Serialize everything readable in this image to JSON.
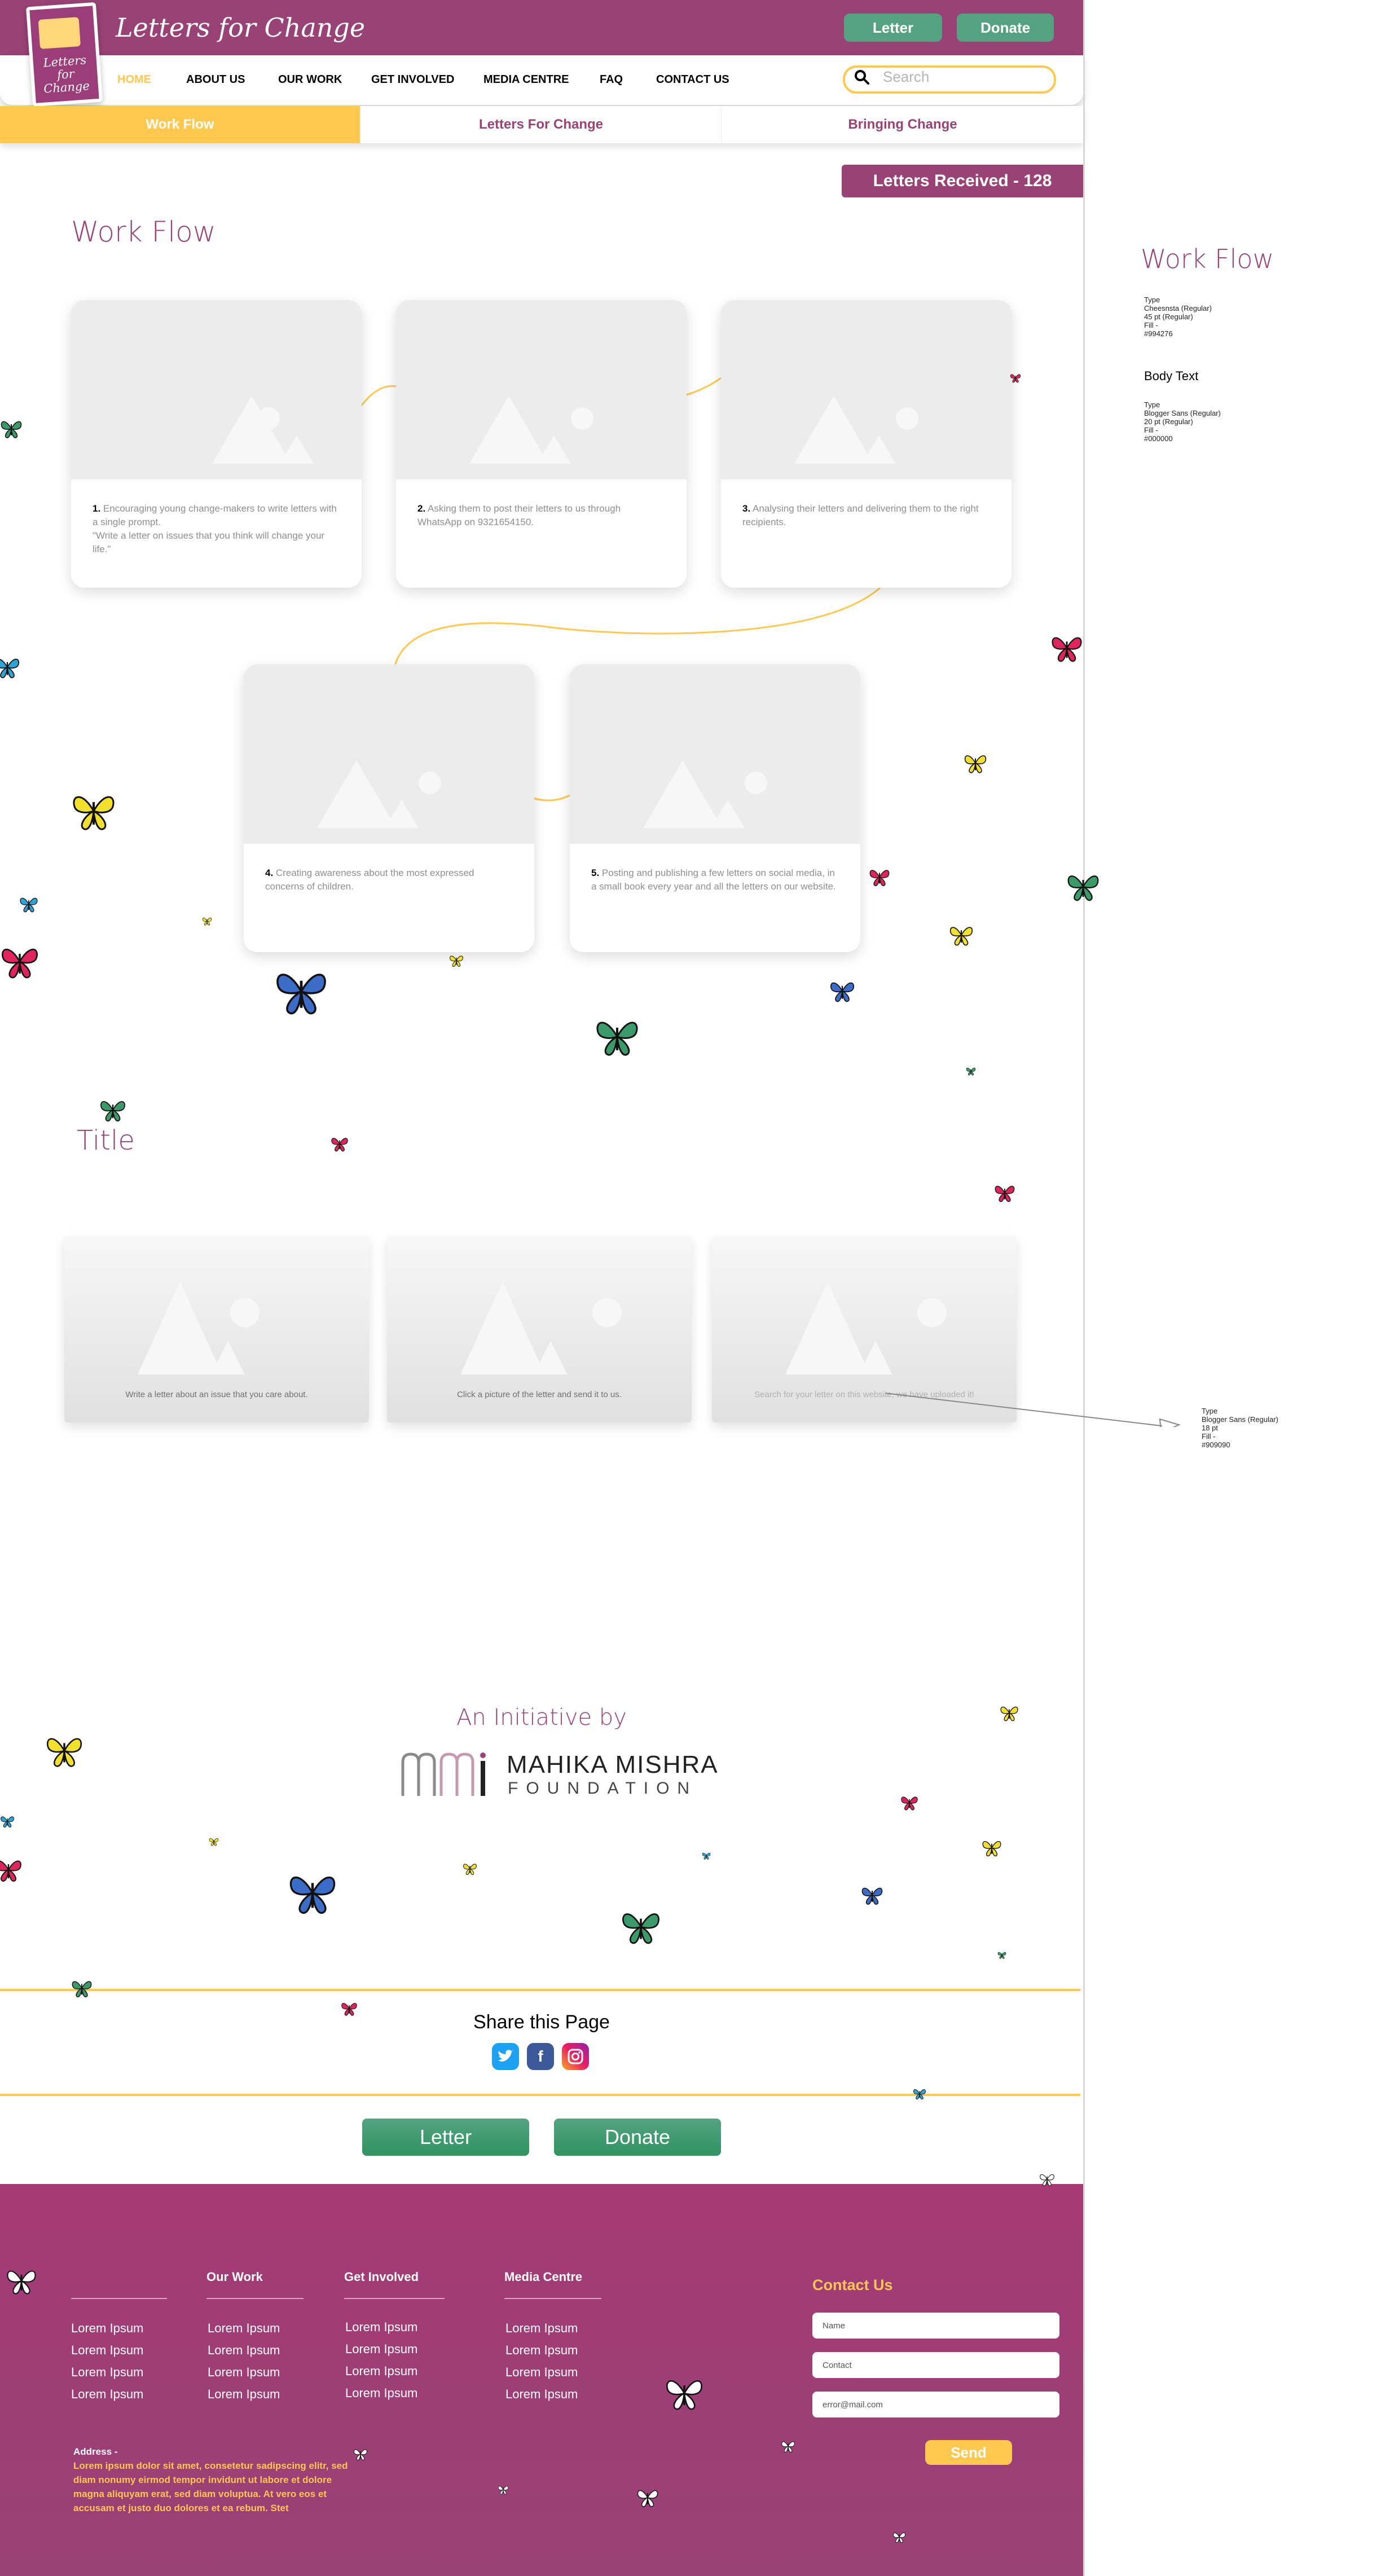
{
  "header": {
    "site_title": "Letters for Change",
    "logo_text": "Letters for Change",
    "letter_button": "Letter",
    "donate_button": "Donate",
    "search_placeholder": "Search"
  },
  "nav": {
    "items": [
      "HOME",
      "ABOUT US",
      "OUR WORK",
      "GET INVOLVED",
      "MEDIA CENTRE",
      "FAQ",
      "CONTACT US"
    ],
    "active_index": 0
  },
  "tabs": [
    "Work Flow",
    "Letters For Change",
    "Bringing Change"
  ],
  "letters_received": "Letters Received - 128",
  "workflow": {
    "title": "Work Flow",
    "steps": [
      {
        "num": "1.",
        "text": "Encouraging young change-makers  to write letters with a single prompt.\n\"Write a letter on issues that you think will change your life.\""
      },
      {
        "num": "2.",
        "text": "Asking them to post their letters to us through WhatsApp on 9321654150."
      },
      {
        "num": "3.",
        "text": "Analysing their letters and delivering them to the right recipients."
      },
      {
        "num": "4.",
        "text": "Creating awareness about the most expressed concerns of children."
      },
      {
        "num": "5.",
        "text": "Posting and publishing a few letters on social media, in a small book every year and all the letters on our website."
      }
    ]
  },
  "features": {
    "title": "Title",
    "items": [
      "Write a letter about an issue that you care about.",
      "Click a picture of the letter and send it to us.",
      "Search for your letter on this website, we have uploaded it!"
    ]
  },
  "annotations": {
    "heading_sample": "Work Flow",
    "heading_spec": "Type\nCheesnsta (Regular)\n45 pt (Regular)\nFill -\n#994276",
    "body_sample": "Body Text",
    "body_spec": "Type\nBlogger Sans (Regular)\n20 pt (Regular)\nFill -\n#000000",
    "caption_spec": "Type\nBlogger Sans (Regular)\n18 pt\nFill -\n#909090"
  },
  "initiative": {
    "title": "An Initiative by",
    "org_name": "MAHIKA MISHRA",
    "org_sub": "FOUNDATION"
  },
  "share": {
    "title": "Share this Page",
    "icons": [
      "twitter-icon",
      "facebook-icon",
      "instagram-icon"
    ]
  },
  "cta": {
    "letter": "Letter",
    "donate": "Donate"
  },
  "footer": {
    "columns": [
      {
        "heading": "",
        "items": [
          "Lorem Ipsum",
          "Lorem Ipsum",
          "Lorem Ipsum",
          "Lorem Ipsum"
        ]
      },
      {
        "heading": "Our Work",
        "items": [
          "Lorem Ipsum",
          "Lorem Ipsum",
          "Lorem Ipsum",
          "Lorem Ipsum"
        ]
      },
      {
        "heading": "Get Involved",
        "items": [
          "Lorem Ipsum",
          "Lorem Ipsum",
          "Lorem Ipsum",
          "Lorem Ipsum"
        ]
      },
      {
        "heading": "Media Centre",
        "items": [
          "Lorem Ipsum",
          "Lorem Ipsum",
          "Lorem Ipsum",
          "Lorem Ipsum"
        ]
      }
    ],
    "contact": {
      "heading": "Contact Us",
      "name_placeholder": "Name",
      "contact_placeholder": "Contact",
      "email_placeholder": "error@mail.com",
      "send": "Send"
    },
    "address_label": "Address -",
    "address_text": "Lorem ipsum dolor sit amet, consetetur sadipscing elitr, sed diam nonumy eirmod tempor invidunt ut labore et dolore magna aliquyam erat, sed diam voluptua. At vero eos et accusam et justo duo dolores et ea rebum. Stet"
  },
  "colors": {
    "brand_purple": "#994276",
    "accent_yellow": "#ffc84f",
    "button_green": "#55a282"
  }
}
